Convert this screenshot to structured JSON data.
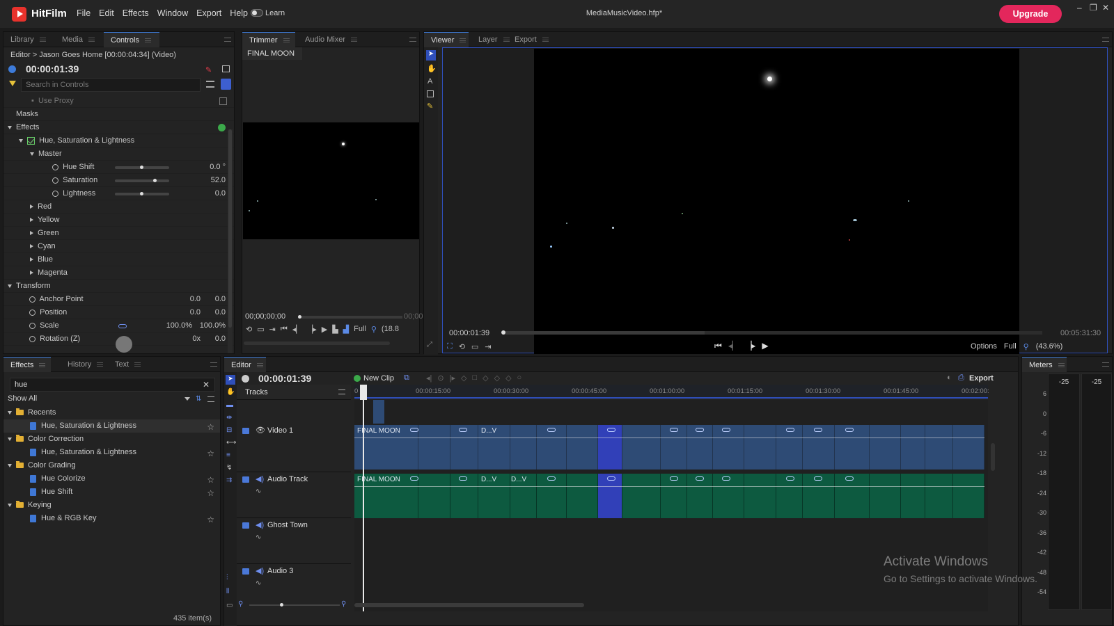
{
  "app": {
    "name": "HitFilm",
    "file": "MediaMusicVideo.hfp*",
    "learn_label": "Learn",
    "upgrade_label": "Upgrade"
  },
  "menu": [
    "File",
    "Edit",
    "Effects",
    "Window",
    "Export",
    "Help"
  ],
  "window_controls": {
    "minimize": "–",
    "maximize": "❐",
    "close": "✕"
  },
  "controls_panel": {
    "tabs": [
      "Library",
      "Media",
      "Controls"
    ],
    "breadcrumb": "Editor > Jason Goes Home [00:00:04:34] (Video)",
    "timecode": "00:00:01:39",
    "search_placeholder": "Search in Controls",
    "use_proxy": "Use Proxy",
    "masks": "Masks",
    "effects": "Effects",
    "effect_name": "Hue, Saturation & Lightness",
    "master": "Master",
    "params": [
      {
        "label": "Hue Shift",
        "value": "0.0 °",
        "level": 0.5
      },
      {
        "label": "Saturation",
        "value": "52.0",
        "level": 0.76
      },
      {
        "label": "Lightness",
        "value": "0.0",
        "level": 0.5
      }
    ],
    "channels": [
      "Red",
      "Yellow",
      "Green",
      "Cyan",
      "Blue",
      "Magenta"
    ],
    "transform": "Transform",
    "transform_params": [
      {
        "label": "Anchor Point",
        "v1": "0.0",
        "v2": "0.0"
      },
      {
        "label": "Position",
        "v1": "0.0",
        "v2": "0.0"
      },
      {
        "label": "Scale",
        "v1": "100.0%",
        "v2": "100.0%"
      },
      {
        "label": "Rotation (Z)",
        "v1": "0x",
        "v2": "0.0"
      }
    ]
  },
  "trimmer": {
    "tabs": [
      "Trimmer",
      "Audio Mixer"
    ],
    "clip_name": "FINAL MOON",
    "timecode": "00;00;00;00",
    "timecode_end": "00;00",
    "quality": "Full",
    "zoom": "(18.8"
  },
  "viewer": {
    "tabs": [
      "Viewer",
      "Layer",
      "Export"
    ],
    "timecode": "00:00:01:39",
    "duration": "00:05:31:30",
    "options": "Options",
    "quality": "Full",
    "zoom": "(43.6%)"
  },
  "effects_panel": {
    "tabs": [
      "Effects",
      "History",
      "Text"
    ],
    "search_value": "hue",
    "filter": "Show All",
    "groups": [
      {
        "name": "Recents",
        "items": [
          "Hue, Saturation & Lightness"
        ]
      },
      {
        "name": "Color Correction",
        "items": [
          "Hue, Saturation & Lightness"
        ]
      },
      {
        "name": "Color Grading",
        "items": [
          "Hue Colorize",
          "Hue Shift"
        ]
      },
      {
        "name": "Keying",
        "items": [
          "Hue & RGB Key"
        ]
      }
    ],
    "count": "435 item(s)"
  },
  "editor": {
    "tab": "Editor",
    "timecode": "00:00:01:39",
    "new_clip": "New Clip",
    "export": "Export",
    "tracks_label": "Tracks",
    "ruler": [
      "0",
      "00:00:15:00",
      "00:00:30:00",
      "00:00:45:00",
      "00:01:00:00",
      "00:01:15:00",
      "00:01:30:00",
      "00:01:45:00",
      "00:02:00:"
    ],
    "tracks": [
      "Video 1",
      "Audio Track",
      "Ghost Town",
      "Audio 3"
    ],
    "clip_labels": {
      "final_moon": "FINAL MOON",
      "dv": "D...V"
    }
  },
  "meters": {
    "tab": "Meters",
    "channels": [
      "-25",
      "-25"
    ],
    "scale": [
      "6",
      "0",
      "-6",
      "-12",
      "-18",
      "-24",
      "-30",
      "-36",
      "-42",
      "-48",
      "-54"
    ]
  },
  "watermark": {
    "title": "Activate Windows",
    "subtitle": "Go to Settings to activate Windows."
  },
  "colors": {
    "accent": "#3d7bd9",
    "upgrade": "#e3275c",
    "video_clip": "#2e4b75",
    "audio_clip": "#0d5a40",
    "selected_clip": "#3140b8"
  }
}
